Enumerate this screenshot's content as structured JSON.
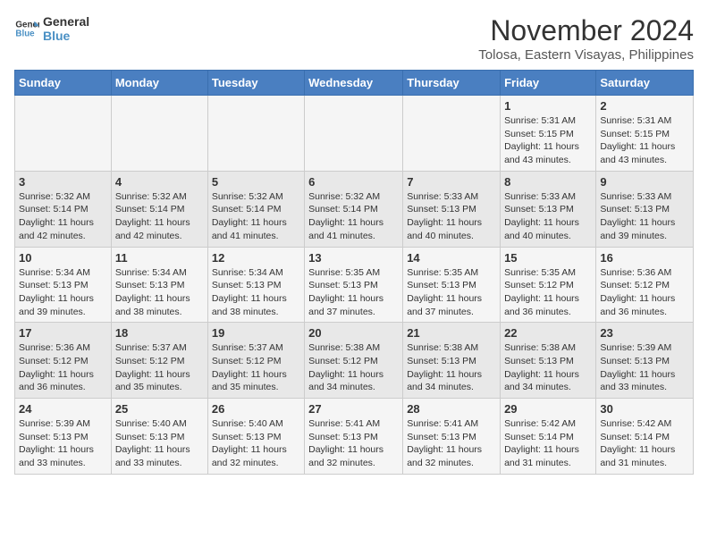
{
  "header": {
    "logo_line1": "General",
    "logo_line2": "Blue",
    "month_year": "November 2024",
    "location": "Tolosa, Eastern Visayas, Philippines"
  },
  "weekdays": [
    "Sunday",
    "Monday",
    "Tuesday",
    "Wednesday",
    "Thursday",
    "Friday",
    "Saturday"
  ],
  "weeks": [
    [
      {
        "day": "",
        "info": ""
      },
      {
        "day": "",
        "info": ""
      },
      {
        "day": "",
        "info": ""
      },
      {
        "day": "",
        "info": ""
      },
      {
        "day": "",
        "info": ""
      },
      {
        "day": "1",
        "info": "Sunrise: 5:31 AM\nSunset: 5:15 PM\nDaylight: 11 hours and 43 minutes."
      },
      {
        "day": "2",
        "info": "Sunrise: 5:31 AM\nSunset: 5:15 PM\nDaylight: 11 hours and 43 minutes."
      }
    ],
    [
      {
        "day": "3",
        "info": "Sunrise: 5:32 AM\nSunset: 5:14 PM\nDaylight: 11 hours and 42 minutes."
      },
      {
        "day": "4",
        "info": "Sunrise: 5:32 AM\nSunset: 5:14 PM\nDaylight: 11 hours and 42 minutes."
      },
      {
        "day": "5",
        "info": "Sunrise: 5:32 AM\nSunset: 5:14 PM\nDaylight: 11 hours and 41 minutes."
      },
      {
        "day": "6",
        "info": "Sunrise: 5:32 AM\nSunset: 5:14 PM\nDaylight: 11 hours and 41 minutes."
      },
      {
        "day": "7",
        "info": "Sunrise: 5:33 AM\nSunset: 5:13 PM\nDaylight: 11 hours and 40 minutes."
      },
      {
        "day": "8",
        "info": "Sunrise: 5:33 AM\nSunset: 5:13 PM\nDaylight: 11 hours and 40 minutes."
      },
      {
        "day": "9",
        "info": "Sunrise: 5:33 AM\nSunset: 5:13 PM\nDaylight: 11 hours and 39 minutes."
      }
    ],
    [
      {
        "day": "10",
        "info": "Sunrise: 5:34 AM\nSunset: 5:13 PM\nDaylight: 11 hours and 39 minutes."
      },
      {
        "day": "11",
        "info": "Sunrise: 5:34 AM\nSunset: 5:13 PM\nDaylight: 11 hours and 38 minutes."
      },
      {
        "day": "12",
        "info": "Sunrise: 5:34 AM\nSunset: 5:13 PM\nDaylight: 11 hours and 38 minutes."
      },
      {
        "day": "13",
        "info": "Sunrise: 5:35 AM\nSunset: 5:13 PM\nDaylight: 11 hours and 37 minutes."
      },
      {
        "day": "14",
        "info": "Sunrise: 5:35 AM\nSunset: 5:13 PM\nDaylight: 11 hours and 37 minutes."
      },
      {
        "day": "15",
        "info": "Sunrise: 5:35 AM\nSunset: 5:12 PM\nDaylight: 11 hours and 36 minutes."
      },
      {
        "day": "16",
        "info": "Sunrise: 5:36 AM\nSunset: 5:12 PM\nDaylight: 11 hours and 36 minutes."
      }
    ],
    [
      {
        "day": "17",
        "info": "Sunrise: 5:36 AM\nSunset: 5:12 PM\nDaylight: 11 hours and 36 minutes."
      },
      {
        "day": "18",
        "info": "Sunrise: 5:37 AM\nSunset: 5:12 PM\nDaylight: 11 hours and 35 minutes."
      },
      {
        "day": "19",
        "info": "Sunrise: 5:37 AM\nSunset: 5:12 PM\nDaylight: 11 hours and 35 minutes."
      },
      {
        "day": "20",
        "info": "Sunrise: 5:38 AM\nSunset: 5:12 PM\nDaylight: 11 hours and 34 minutes."
      },
      {
        "day": "21",
        "info": "Sunrise: 5:38 AM\nSunset: 5:13 PM\nDaylight: 11 hours and 34 minutes."
      },
      {
        "day": "22",
        "info": "Sunrise: 5:38 AM\nSunset: 5:13 PM\nDaylight: 11 hours and 34 minutes."
      },
      {
        "day": "23",
        "info": "Sunrise: 5:39 AM\nSunset: 5:13 PM\nDaylight: 11 hours and 33 minutes."
      }
    ],
    [
      {
        "day": "24",
        "info": "Sunrise: 5:39 AM\nSunset: 5:13 PM\nDaylight: 11 hours and 33 minutes."
      },
      {
        "day": "25",
        "info": "Sunrise: 5:40 AM\nSunset: 5:13 PM\nDaylight: 11 hours and 33 minutes."
      },
      {
        "day": "26",
        "info": "Sunrise: 5:40 AM\nSunset: 5:13 PM\nDaylight: 11 hours and 32 minutes."
      },
      {
        "day": "27",
        "info": "Sunrise: 5:41 AM\nSunset: 5:13 PM\nDaylight: 11 hours and 32 minutes."
      },
      {
        "day": "28",
        "info": "Sunrise: 5:41 AM\nSunset: 5:13 PM\nDaylight: 11 hours and 32 minutes."
      },
      {
        "day": "29",
        "info": "Sunrise: 5:42 AM\nSunset: 5:14 PM\nDaylight: 11 hours and 31 minutes."
      },
      {
        "day": "30",
        "info": "Sunrise: 5:42 AM\nSunset: 5:14 PM\nDaylight: 11 hours and 31 minutes."
      }
    ]
  ]
}
